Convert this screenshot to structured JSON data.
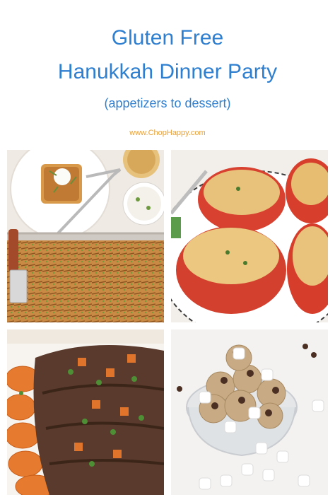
{
  "header": {
    "title_line1": "Gluten Free",
    "title_line2": "Hanukkah Dinner Party",
    "subtitle": "(appetizers to dessert)",
    "website": "www.ChopHappy.com"
  },
  "colors": {
    "title": "#2f7fd0",
    "website": "#e8a13a"
  },
  "photos": [
    {
      "name": "latke-appetizer-photo"
    },
    {
      "name": "stuffed-tomatoes-photo"
    },
    {
      "name": "brisket-carrots-photo"
    },
    {
      "name": "cookie-dough-dessert-photo"
    }
  ]
}
